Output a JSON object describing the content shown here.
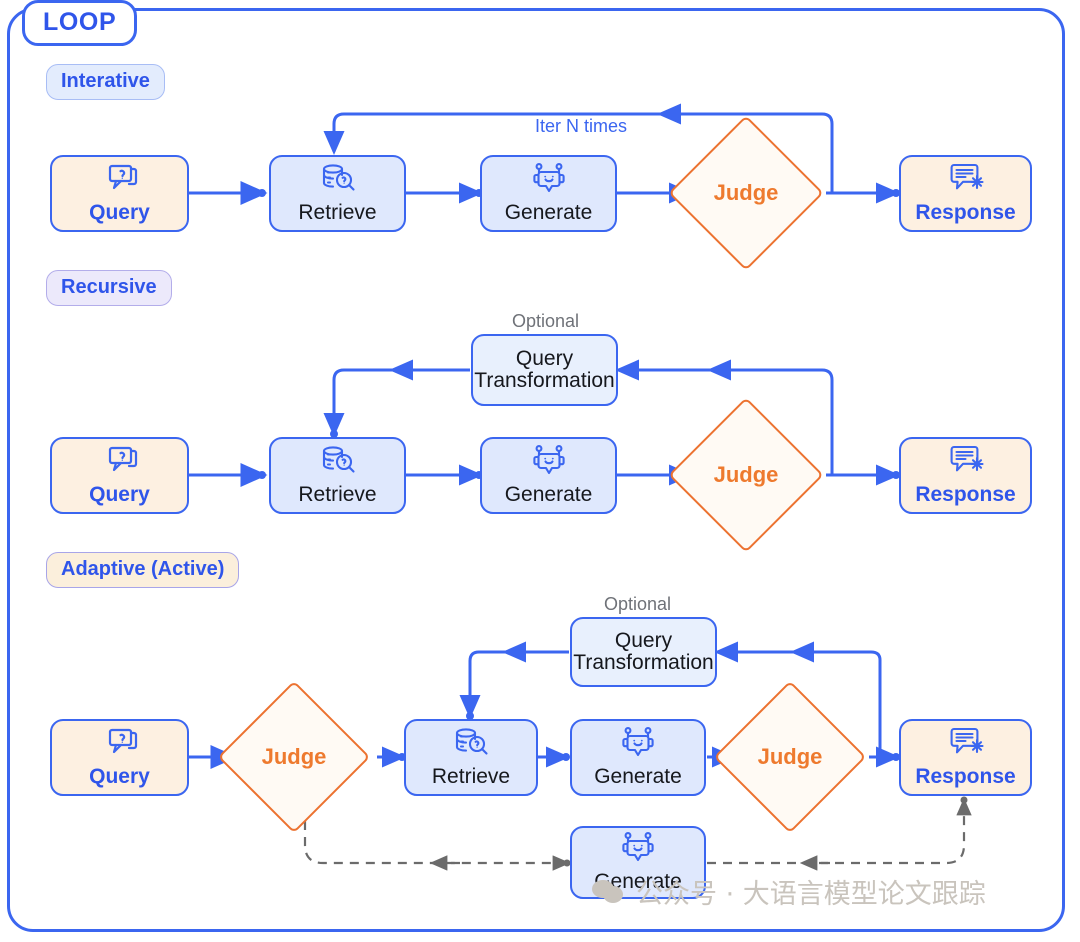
{
  "frame": {
    "title": "LOOP"
  },
  "sections": [
    {
      "id": "iterative",
      "tab": "Interative",
      "nodes": [
        {
          "name": "query",
          "label": "Query",
          "icon": "query-bubble-icon"
        },
        {
          "name": "retrieve",
          "label": "Retrieve",
          "icon": "database-search-icon"
        },
        {
          "name": "generate",
          "label": "Generate",
          "icon": "robot-icon"
        },
        {
          "name": "judge",
          "label": "Judge",
          "icon": "diamond-shape"
        },
        {
          "name": "response",
          "label": "Response",
          "icon": "response-bubble-icon"
        }
      ],
      "edge_labels": [
        "Iter N times"
      ]
    },
    {
      "id": "recursive",
      "tab": "Recursive",
      "optional_caption": "Optional",
      "nodes": [
        {
          "name": "query",
          "label": "Query",
          "icon": "query-bubble-icon"
        },
        {
          "name": "retrieve",
          "label": "Retrieve",
          "icon": "database-search-icon"
        },
        {
          "name": "generate",
          "label": "Generate",
          "icon": "robot-icon"
        },
        {
          "name": "judge",
          "label": "Judge",
          "icon": "diamond-shape"
        },
        {
          "name": "response",
          "label": "Response",
          "icon": "response-bubble-icon"
        },
        {
          "name": "query-transformation",
          "label_line1": "Query",
          "label_line2": "Transformation",
          "icon": "none"
        }
      ]
    },
    {
      "id": "adaptive",
      "tab": "Adaptive (Active)",
      "optional_caption": "Optional",
      "nodes": [
        {
          "name": "query",
          "label": "Query",
          "icon": "query-bubble-icon"
        },
        {
          "name": "judge-1",
          "label": "Judge",
          "icon": "diamond-shape"
        },
        {
          "name": "retrieve",
          "label": "Retrieve",
          "icon": "database-search-icon"
        },
        {
          "name": "generate",
          "label": "Generate",
          "icon": "robot-icon"
        },
        {
          "name": "judge-2",
          "label": "Judge",
          "icon": "diamond-shape"
        },
        {
          "name": "response",
          "label": "Response",
          "icon": "response-bubble-icon"
        },
        {
          "name": "generate-direct",
          "label": "Generate",
          "icon": "robot-icon"
        },
        {
          "name": "query-transformation",
          "label_line1": "Query",
          "label_line2": "Transformation",
          "icon": "none"
        }
      ]
    }
  ],
  "labels": {
    "optional": "Optional",
    "iter_n_times": "Iter N times",
    "query": "Query",
    "retrieve": "Retrieve",
    "generate": "Generate",
    "judge": "Judge",
    "response": "Response",
    "query_transformation_line1": "Query",
    "query_transformation_line2": "Transformation"
  },
  "watermark": {
    "text": "公众号 · 大语言模型论文跟踪",
    "icon": "wechat-icon"
  },
  "colors": {
    "primary_blue": "#3b66f0",
    "label_blue": "#2f55ea",
    "orange": "#ec7230",
    "cream_node": "#fdf0e1",
    "blue_node": "#dfe8fd",
    "pale_blue_node": "#e8f0fd",
    "section_iterative_bg": "#f1f6fe",
    "section_recursive_bg": "#f6f4fd",
    "section_adaptive_bg": "#fdf8f0",
    "dashed_gray": "#6b6b6b",
    "caption_gray": "#6f7278",
    "watermark_gray": "#c9c4bd"
  }
}
